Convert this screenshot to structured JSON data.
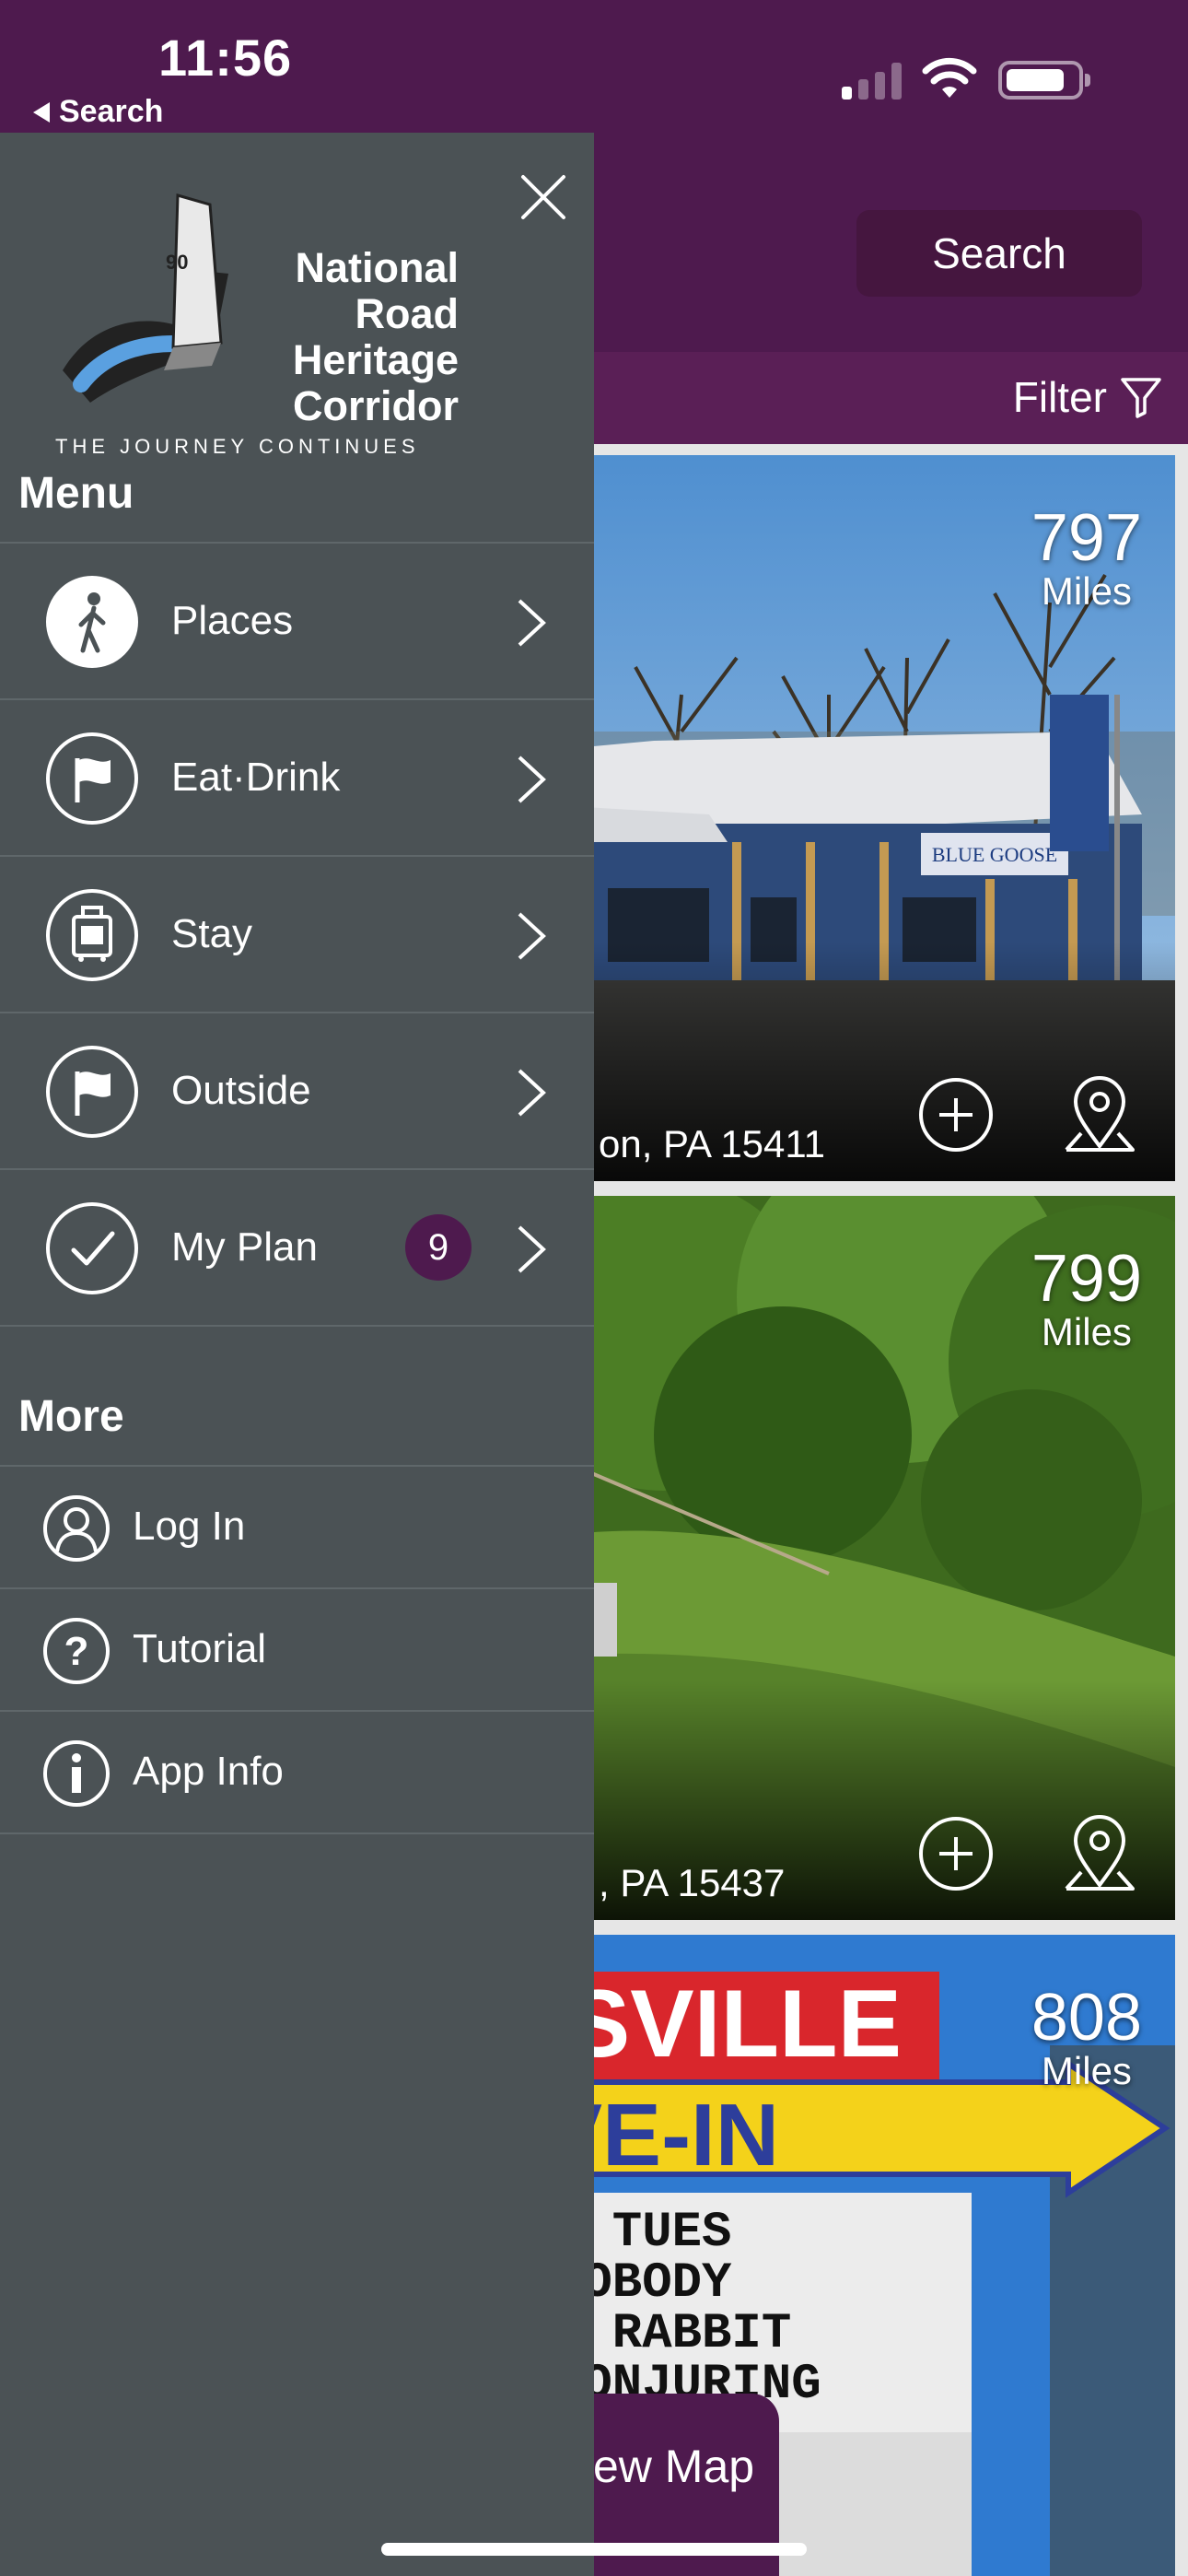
{
  "status_bar": {
    "time": "11:56",
    "back_label": "Search"
  },
  "header": {
    "search_label": "Search",
    "filter_label": "Filter"
  },
  "cards": [
    {
      "miles_value": "797",
      "miles_unit": "Miles",
      "address": "on, PA 15411"
    },
    {
      "miles_value": "799",
      "miles_unit": "Miles",
      "address": ", PA 15437"
    },
    {
      "miles_value": "808",
      "miles_unit": "Miles",
      "address": ""
    }
  ],
  "map_tab": {
    "label": "ew Map"
  },
  "drawer": {
    "logo": {
      "title_line1": "National",
      "title_line2": "Road",
      "title_line3": "Heritage",
      "title_line4": "Corridor",
      "tagline": "THE JOURNEY CONTINUES",
      "marker_text": "90"
    },
    "menu_heading": "Menu",
    "menu_items": [
      {
        "label": "Places",
        "icon": "walker-icon"
      },
      {
        "label": "Eat·Drink",
        "icon": "flag-icon"
      },
      {
        "label": "Stay",
        "icon": "luggage-icon"
      },
      {
        "label": "Outside",
        "icon": "flag-icon"
      },
      {
        "label": "My Plan",
        "icon": "checkmark-icon",
        "badge": "9"
      }
    ],
    "more_heading": "More",
    "more_items": [
      {
        "label": "Log In",
        "icon": "user-icon"
      },
      {
        "label": "Tutorial",
        "icon": "question-icon"
      },
      {
        "label": "App Info",
        "icon": "info-icon"
      }
    ]
  },
  "colors": {
    "brand_purple": "#4e1a4e",
    "drawer_bg": "#4b5255",
    "divider": "#5f676a"
  }
}
